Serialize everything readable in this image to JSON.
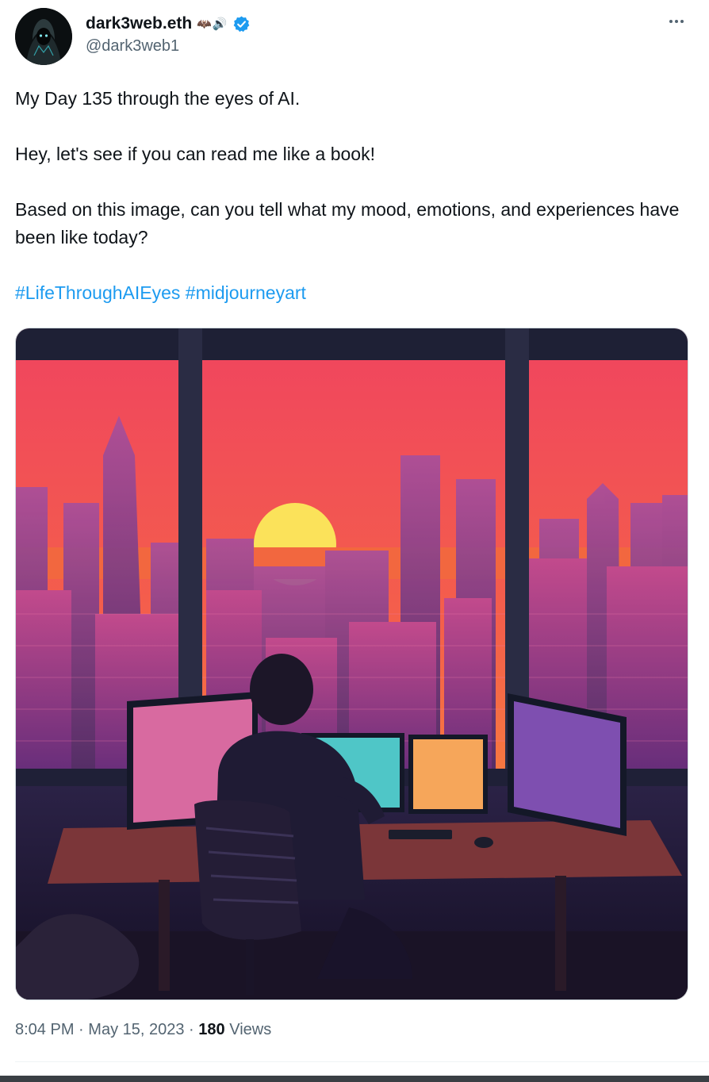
{
  "author": {
    "display_name": "dark3web.eth",
    "name_emojis": "🦇🔊",
    "handle": "@dark3web1",
    "verified_color": "#1d9bf0"
  },
  "tweet": {
    "lines": [
      "My Day 135 through the eyes of AI.",
      "Hey, let's see if you can read me like a book!",
      "Based on this image, can you tell what my mood, emotions, and experiences have been like today?"
    ],
    "hashtags": [
      "#LifeThroughAIEyes",
      "#midjourneyart"
    ]
  },
  "media": {
    "icon": "image"
  },
  "meta": {
    "time": "8:04 PM",
    "separator": "·",
    "date": "May 15, 2023",
    "views_count": "180",
    "views_label": "Views"
  },
  "colors": {
    "accent": "#1d9bf0",
    "secondary_text": "#536471",
    "primary_text": "#0f1419"
  }
}
